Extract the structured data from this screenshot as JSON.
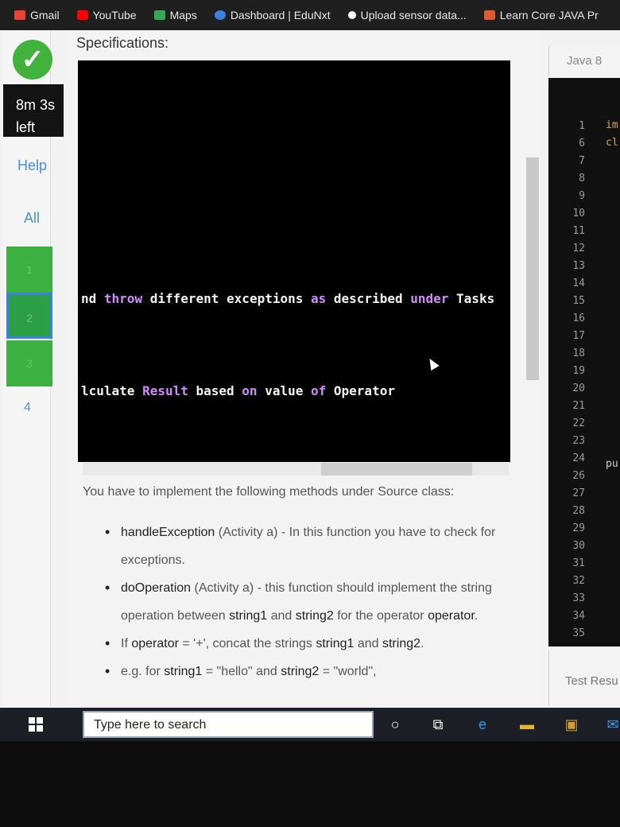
{
  "bookmarks": [
    {
      "label": "Gmail",
      "icon": "gmail-icon",
      "color": "#ea4335"
    },
    {
      "label": "YouTube",
      "icon": "youtube-icon",
      "color": "#ff0000"
    },
    {
      "label": "Maps",
      "icon": "maps-icon",
      "color": "#34a853"
    },
    {
      "label": "Dashboard | EduNxt",
      "icon": "edunxt-icon",
      "color": "#3b82e0"
    },
    {
      "label": "Upload sensor data...",
      "icon": "upload-icon",
      "color": "#ffffff"
    },
    {
      "label": "Learn Core JAVA Pr",
      "icon": "learn-icon",
      "color": "#e05a2b"
    }
  ],
  "sidebar": {
    "timer_value": "8m 3s",
    "timer_suffix": "left",
    "help_label": "Help",
    "all_label": "All",
    "questions": [
      "1",
      "2",
      "3",
      "4"
    ]
  },
  "content": {
    "title": "Specifications:",
    "terminal_line1": {
      "a": "nd ",
      "b": "throw",
      "c": " different exceptions ",
      "d": "as",
      "e": " described ",
      "f": "under",
      "g": " Tasks"
    },
    "terminal_line2": {
      "a": "lculate ",
      "b": "Result",
      "c": " based ",
      "d": "on",
      "e": " value ",
      "f": "of",
      "g": " Operator"
    },
    "intro": "You have to implement the following methods under Source class:",
    "tasks": [
      {
        "name": "handleException",
        "rest": " (Activity a) - In this function you have to check for exceptions."
      },
      {
        "name": "doOperation",
        "rest": " (Activity a) - this function should implement the string operation between ",
        "s1": "string1",
        "mid": " and ",
        "s2": "string2",
        "tail": " for the operator ",
        "op": "operator",
        "end": "."
      },
      {
        "p1": "If ",
        "name": "operator",
        "p2": " = '+', concat the strings ",
        "s1": "string1",
        "mid": " and ",
        "s2": "string2",
        "end": "."
      },
      {
        "p1": "e.g. for ",
        "s1": "string1",
        "v1": " = \"hello\" and ",
        "s2": "string2",
        "v2": " = \"world\","
      }
    ]
  },
  "editor": {
    "language": "Java 8",
    "line_numbers": [
      "1",
      "6",
      "7",
      "8",
      "9",
      "10",
      "11",
      "12",
      "13",
      "14",
      "15",
      "16",
      "17",
      "18",
      "19",
      "20",
      "21",
      "22",
      "23",
      "24",
      "26",
      "27",
      "28",
      "29",
      "30",
      "31",
      "32",
      "33",
      "34",
      "35"
    ],
    "frag_import": "im",
    "frag_class": "cl",
    "frag_public": "pu",
    "test_results": "Test Resu"
  },
  "taskbar": {
    "search_placeholder": "Type here to search"
  }
}
